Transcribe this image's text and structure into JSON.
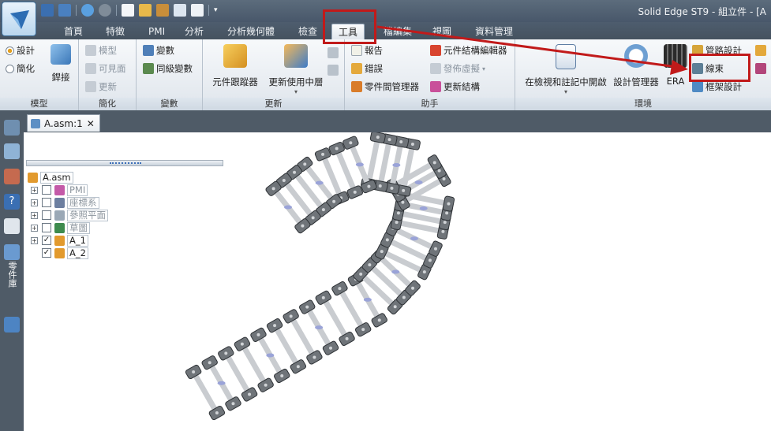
{
  "window_title": "Solid Edge ST9 - 組立件 - [A",
  "tabs": [
    "首頁",
    "特徵",
    "PMI",
    "分析",
    "分析幾何體",
    "檢查",
    "工具",
    "檔編集",
    "視圖",
    "資料管理"
  ],
  "active_tab": "工具",
  "ribbon": {
    "model": {
      "label": "模型",
      "radio_design": "設計",
      "radio_simplify": "簡化",
      "weld": "銲接"
    },
    "simplify": {
      "label": "簡化",
      "model": "模型",
      "visible_face": "可見面",
      "update": "更新"
    },
    "variables": {
      "label": "變數",
      "variables": "變數",
      "sync_variables": "同級變數"
    },
    "update": {
      "label": "更新",
      "component_tracker": "元件跟蹤器",
      "update_active": "更新使用中層"
    },
    "assistant": {
      "label": "助手",
      "report": "報告",
      "error": "錯誤",
      "part_manager": "零件間管理器",
      "structure_editor": "元件結構編輯器",
      "publish_virtual": "發佈虛擬",
      "update_structure": "更新結構"
    },
    "environment": {
      "label": "環境",
      "open_in_viewer": "在檢視和註記中開啟",
      "design_manager": "設計管理器",
      "era": "ERA",
      "pipe_design": "管路設計",
      "wire_harness": "線束",
      "frame_design": "框架設計"
    }
  },
  "doc_tab": "A.asm:1",
  "tree": {
    "root": "A.asm",
    "items": [
      {
        "label": "PMI",
        "checked": false,
        "expandable": true,
        "dim": true
      },
      {
        "label": "座標系",
        "checked": false,
        "expandable": true,
        "dim": true
      },
      {
        "label": "參照平面",
        "checked": false,
        "expandable": true,
        "dim": true
      },
      {
        "label": "草圖",
        "checked": false,
        "expandable": true,
        "dim": true
      },
      {
        "label": "A_1",
        "checked": true,
        "expandable": true,
        "dim": false
      },
      {
        "label": "A_2",
        "checked": true,
        "expandable": false,
        "dim": false
      }
    ]
  },
  "left_panel_label": "零件庫",
  "colors": {
    "highlight_red": "#c11a1a",
    "chain_gray": "#6f7479"
  }
}
